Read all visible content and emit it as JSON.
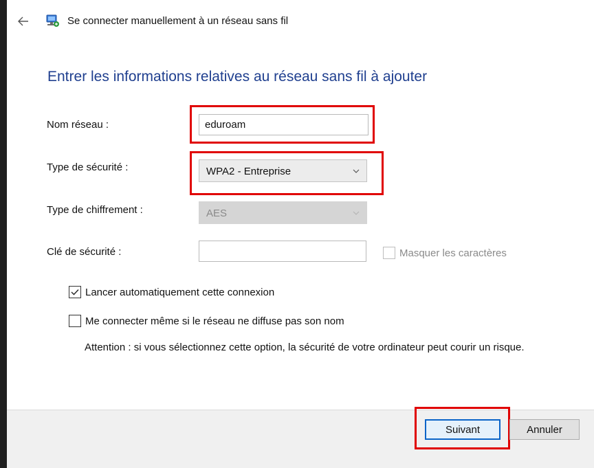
{
  "window": {
    "title": "Se connecter manuellement à un réseau sans fil",
    "back_icon": "back-arrow-icon",
    "network_icon": "wireless-network-icon"
  },
  "heading": "Entrer les informations relatives au réseau sans fil à ajouter",
  "form": {
    "network_name": {
      "label": "Nom réseau :",
      "value": "eduroam"
    },
    "security_type": {
      "label": "Type de sécurité :",
      "value": "WPA2 - Entreprise"
    },
    "encryption_type": {
      "label": "Type de chiffrement :",
      "value": "AES"
    },
    "security_key": {
      "label": "Clé de sécurité :",
      "value": ""
    },
    "hide_characters": {
      "label": "Masquer les caractères",
      "checked": false,
      "enabled": false
    }
  },
  "options": {
    "auto_connect": {
      "label": "Lancer automatiquement cette connexion",
      "checked": true
    },
    "connect_hidden": {
      "label": "Me connecter même si le réseau ne diffuse pas son nom",
      "checked": false
    },
    "warning": "Attention : si vous sélectionnez cette option, la sécurité de votre ordinateur peut courir un risque."
  },
  "buttons": {
    "next": "Suivant",
    "cancel": "Annuler"
  },
  "colors": {
    "highlight": "#e00000",
    "heading": "#1f3f8f",
    "primary_button_border": "#0a64c8"
  }
}
